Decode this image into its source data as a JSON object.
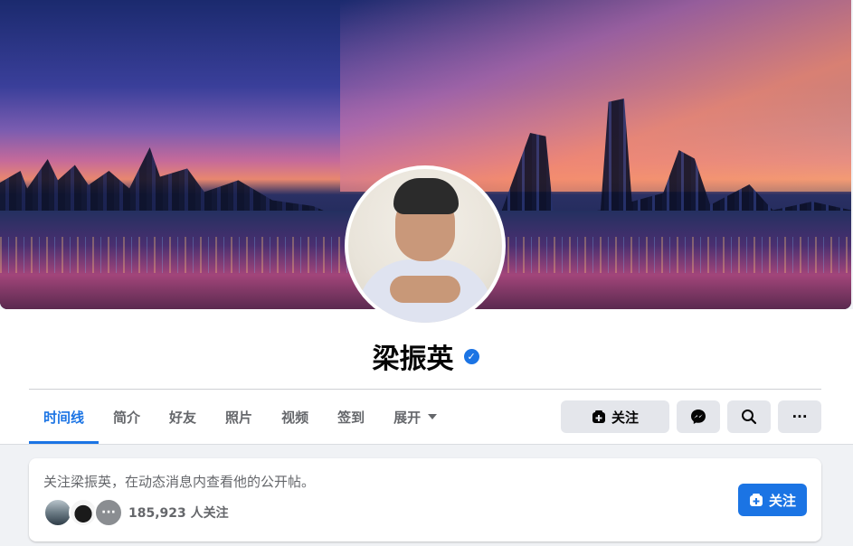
{
  "profile": {
    "name": "梁振英",
    "verified": true,
    "verified_icon": "check-badge-icon"
  },
  "tabs": [
    {
      "label": "时间线",
      "active": true
    },
    {
      "label": "简介",
      "active": false
    },
    {
      "label": "好友",
      "active": false
    },
    {
      "label": "照片",
      "active": false
    },
    {
      "label": "视频",
      "active": false
    },
    {
      "label": "签到",
      "active": false
    },
    {
      "label": "展开",
      "active": false,
      "has_caret": true
    }
  ],
  "actions": {
    "follow_label": "关注",
    "messenger_icon": "messenger-icon",
    "search_icon": "search-icon",
    "more_label": "···"
  },
  "follow_card": {
    "message": "关注梁振英，在动态消息内查看他的公开帖。",
    "followers_count": "185,923 人关注",
    "more_avatars_label": "···",
    "follow_label": "关注"
  },
  "colors": {
    "accent": "#1b74e4",
    "button_gray": "#e4e6eb",
    "secondary_text": "#65676b"
  }
}
